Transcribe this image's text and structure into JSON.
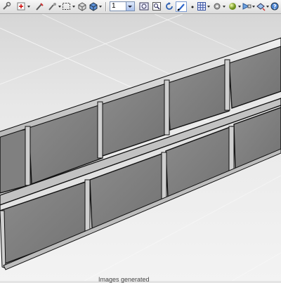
{
  "toolbar": {
    "view_number": "1",
    "items": [
      {
        "name": "wrench-icon"
      },
      {
        "name": "add-point-icon"
      },
      {
        "name": "measure-icon"
      },
      {
        "name": "lasso-select-icon"
      },
      {
        "name": "box-select-icon"
      },
      {
        "name": "shaded-box-icon"
      },
      {
        "name": "solid-cube-icon"
      },
      {
        "name": "fit-view-icon"
      },
      {
        "name": "zoom-window-icon"
      },
      {
        "name": "rotate-view-icon"
      },
      {
        "name": "paint-icon"
      },
      {
        "name": "dot-icon"
      },
      {
        "name": "grid-view-icon"
      },
      {
        "name": "settings-icon"
      },
      {
        "name": "sphere-icon"
      },
      {
        "name": "render-icon"
      },
      {
        "name": "lighting-icon"
      },
      {
        "name": "help-icon"
      }
    ]
  },
  "colors": {
    "toolbar_bg": "#e8e8e8",
    "floor": "#f1f1f1",
    "wall_face": "#7d7d7d",
    "outline": "#111111"
  },
  "status_text": "Images generated"
}
